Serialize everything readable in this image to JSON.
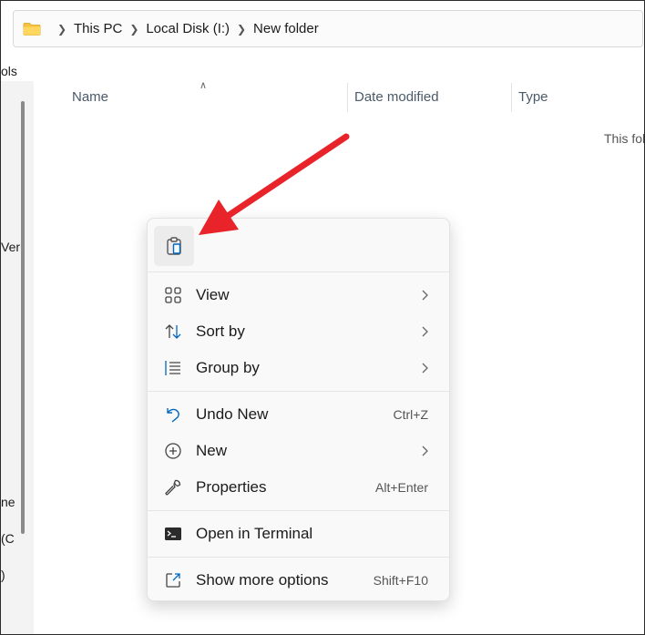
{
  "breadcrumb": [
    "This PC",
    "Local Disk (I:)",
    "New folder"
  ],
  "toolbar_fragment": "ols",
  "nav_fragments": [
    "Ver",
    "ne",
    "(C",
    ")"
  ],
  "columns": [
    "Name",
    "Date modified",
    "Type"
  ],
  "empty_message": "This folder is empty.",
  "menu": {
    "items": [
      {
        "label": "View",
        "icon": "grid-icon",
        "chevron": true
      },
      {
        "label": "Sort by",
        "icon": "sort-icon",
        "chevron": true
      },
      {
        "label": "Group by",
        "icon": "group-icon",
        "chevron": true
      },
      {
        "label": "Undo New",
        "icon": "undo-icon",
        "shortcut": "Ctrl+Z"
      },
      {
        "label": "New",
        "icon": "plus-circle-icon",
        "chevron": true
      },
      {
        "label": "Properties",
        "icon": "wrench-icon",
        "shortcut": "Alt+Enter"
      },
      {
        "label": "Open in Terminal",
        "icon": "terminal-icon"
      },
      {
        "label": "Show more options",
        "icon": "external-icon",
        "shortcut": "Shift+F10"
      }
    ]
  },
  "colors": {
    "accent": "#0067c0",
    "arrow": "#e8232a"
  }
}
